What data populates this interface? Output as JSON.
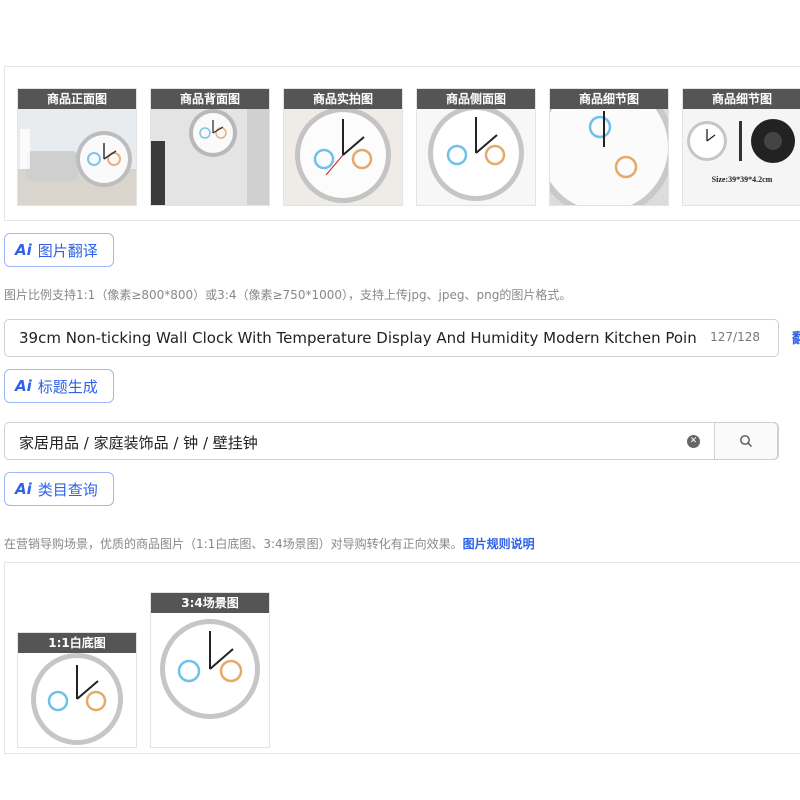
{
  "top_thumbnails": [
    {
      "label": "商品正面图",
      "icon": "clock-room-photo"
    },
    {
      "label": "商品背面图",
      "icon": "clock-wall-photo"
    },
    {
      "label": "商品实拍图",
      "icon": "clock-face-photo"
    },
    {
      "label": "商品侧面图",
      "icon": "clock-face-photo"
    },
    {
      "label": "商品细节图",
      "icon": "clock-closeup-photo"
    },
    {
      "label": "商品细节图",
      "icon": "clock-detail-photo",
      "caption": "Size:39*39*4.2cm"
    }
  ],
  "image_translate_button": {
    "ai": "Ai",
    "label": "图片翻译"
  },
  "image_ratio_hint": "图片比例支持1:1（像素≥800*800）或3:4（像素≥750*1000），支持上传jpg、jpeg、png的图片格式。",
  "title_field": {
    "value": "39cm Non-ticking Wall Clock With Temperature Display And Humidity Modern Kitchen Poin",
    "counter": "127/128"
  },
  "title_generate_button": {
    "ai": "Ai",
    "label": "标题生成"
  },
  "category_field": {
    "value": "家居用品 / 家庭装饰品 / 钟 / 壁挂钟",
    "clear_icon": "clear-icon",
    "search_icon": "search-icon"
  },
  "category_query_button": {
    "ai": "Ai",
    "label": "类目查询"
  },
  "marketing_hint": {
    "text": "在营销导购场景，优质的商品图片（1:1白底图、3:4场景图）对导购转化有正向效果。",
    "link": "图片规则说明"
  },
  "bottom_thumbnails": [
    {
      "label": "1:1白底图",
      "icon": "clock-white-bg-photo"
    },
    {
      "label": "3:4场景图",
      "icon": "clock-scene-photo"
    }
  ],
  "colors": {
    "accent": "#2f62e8",
    "caption_bg": "#555555",
    "border": "#d0d0d0"
  }
}
